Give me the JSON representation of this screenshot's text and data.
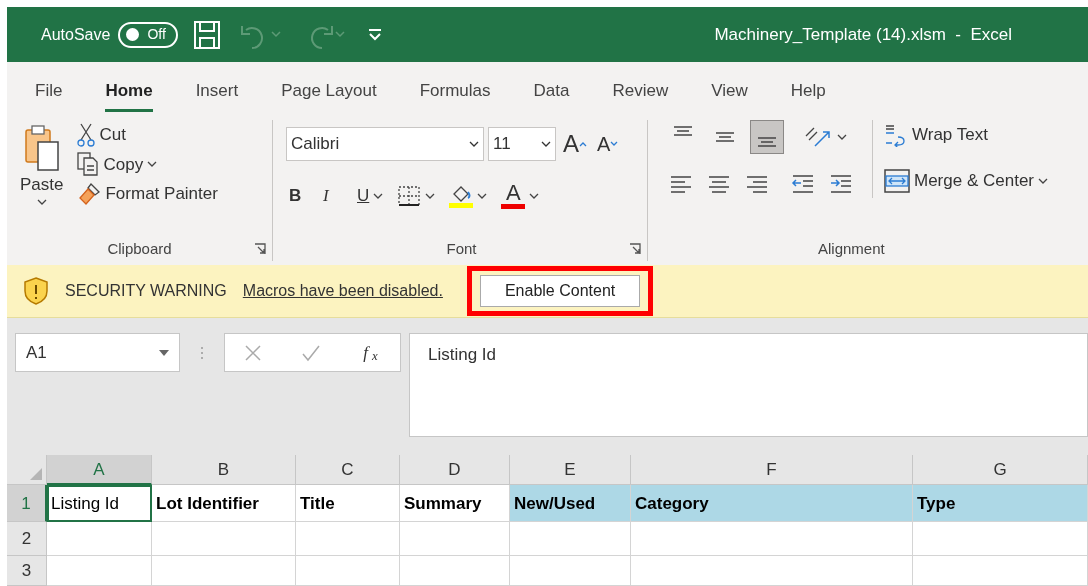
{
  "title_bar": {
    "autosave_label": "AutoSave",
    "autosave_toggle": {
      "label": "Off",
      "on": false
    },
    "quick_access": [
      {
        "kind": "save",
        "disabled": false
      },
      {
        "kind": "undo",
        "disabled": true
      },
      {
        "kind": "redo",
        "disabled": true
      },
      {
        "kind": "customize",
        "disabled": false
      }
    ],
    "document_title": "Machinery_Template (14).xlsm  -  Excel"
  },
  "ribbon_tabs": [
    {
      "label": "File",
      "selected": false
    },
    {
      "label": "Home",
      "selected": true
    },
    {
      "label": "Insert",
      "selected": false
    },
    {
      "label": "Page Layout",
      "selected": false
    },
    {
      "label": "Formulas",
      "selected": false
    },
    {
      "label": "Data",
      "selected": false
    },
    {
      "label": "Review",
      "selected": false
    },
    {
      "label": "View",
      "selected": false
    },
    {
      "label": "Help",
      "selected": false
    }
  ],
  "clipboard_group": {
    "title": "Clipboard",
    "paste": "Paste",
    "cut": "Cut",
    "copy": "Copy",
    "format_painter": "Format Painter"
  },
  "font_group": {
    "title": "Font",
    "font_name": "Calibri",
    "font_size": "11",
    "grow_font": "A",
    "shrink_font": "A",
    "bold": "B",
    "italic": "I",
    "underline": "U",
    "font_color": "A"
  },
  "alignment_group": {
    "title": "Alignment",
    "vertical_align": [
      {
        "kind": "top",
        "selected": false
      },
      {
        "kind": "middle",
        "selected": false
      },
      {
        "kind": "bottom",
        "selected": true
      }
    ],
    "horizontal_align": [
      {
        "kind": "left",
        "selected": false
      },
      {
        "kind": "center",
        "selected": false
      },
      {
        "kind": "right",
        "selected": false
      }
    ],
    "wrap_text": "Wrap Text",
    "merge_center": "Merge & Center"
  },
  "security_bar": {
    "label": "SECURITY WARNING",
    "message": "Macros have been disabled.",
    "button": {
      "label": "Enable Content",
      "highlighted": true
    }
  },
  "formula_bar": {
    "name_box": "A1",
    "function_label": "f$_{x}$",
    "formula": "Listing Id"
  },
  "sheet": {
    "columns": [
      {
        "letter": "A",
        "selected": true
      },
      {
        "letter": "B",
        "selected": false
      },
      {
        "letter": "C",
        "selected": false
      },
      {
        "letter": "D",
        "selected": false
      },
      {
        "letter": "E",
        "selected": false
      },
      {
        "letter": "F",
        "selected": false
      },
      {
        "letter": "G",
        "selected": false
      }
    ],
    "rows": [
      {
        "number": "1",
        "selected": true,
        "cells": [
          {
            "text": "Listing Id",
            "bold": false,
            "highlighted": false,
            "selected": true
          },
          {
            "text": "Lot Identifier",
            "bold": true,
            "highlighted": false,
            "selected": false
          },
          {
            "text": "Title",
            "bold": true,
            "highlighted": false,
            "selected": false
          },
          {
            "text": "Summary",
            "bold": true,
            "highlighted": false,
            "selected": false
          },
          {
            "text": "New/Used",
            "bold": true,
            "highlighted": true,
            "selected": false
          },
          {
            "text": "Category",
            "bold": true,
            "highlighted": true,
            "selected": false
          },
          {
            "text": "Type",
            "bold": true,
            "highlighted": true,
            "selected": false
          }
        ]
      },
      {
        "number": "2",
        "selected": false,
        "cells": []
      },
      {
        "number": "3",
        "selected": false,
        "cells": []
      }
    ]
  }
}
